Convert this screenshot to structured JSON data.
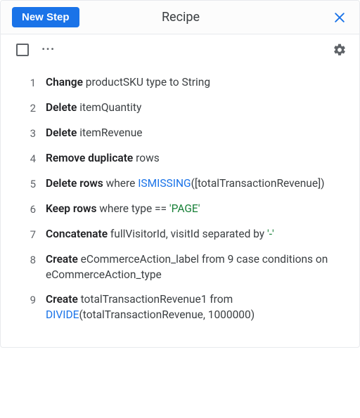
{
  "header": {
    "title": "Recipe",
    "new_step_label": "New Step"
  },
  "steps": [
    {
      "num": "1",
      "parts": [
        {
          "t": "Change ",
          "b": true
        },
        {
          "t": "productSKU type to String"
        }
      ]
    },
    {
      "num": "2",
      "parts": [
        {
          "t": "Delete ",
          "b": true
        },
        {
          "t": "itemQuantity"
        }
      ]
    },
    {
      "num": "3",
      "parts": [
        {
          "t": "Delete ",
          "b": true
        },
        {
          "t": "itemRevenue"
        }
      ]
    },
    {
      "num": "4",
      "parts": [
        {
          "t": "Remove duplicate ",
          "b": true
        },
        {
          "t": "rows"
        }
      ]
    },
    {
      "num": "5",
      "parts": [
        {
          "t": "Delete rows ",
          "b": true
        },
        {
          "t": "where "
        },
        {
          "t": "ISMISSING",
          "fn": true
        },
        {
          "t": "([totalTransactionRevenue])"
        }
      ]
    },
    {
      "num": "6",
      "parts": [
        {
          "t": "Keep rows ",
          "b": true
        },
        {
          "t": "where type == "
        },
        {
          "t": "'PAGE'",
          "str": true
        }
      ]
    },
    {
      "num": "7",
      "parts": [
        {
          "t": "Concatenate ",
          "b": true
        },
        {
          "t": "fullVisitorId, visitId separated by "
        },
        {
          "t": "'-'",
          "str": true
        }
      ]
    },
    {
      "num": "8",
      "parts": [
        {
          "t": "Create ",
          "b": true
        },
        {
          "t": "eCommerceAction_label from 9 case conditions on eCommerceAction_type"
        }
      ]
    },
    {
      "num": "9",
      "parts": [
        {
          "t": "Create ",
          "b": true
        },
        {
          "t": "totalTransactionRevenue1 from "
        },
        {
          "t": "DIVIDE",
          "fn": true
        },
        {
          "t": "(totalTransactionRevenue, 1000000)"
        }
      ]
    }
  ]
}
